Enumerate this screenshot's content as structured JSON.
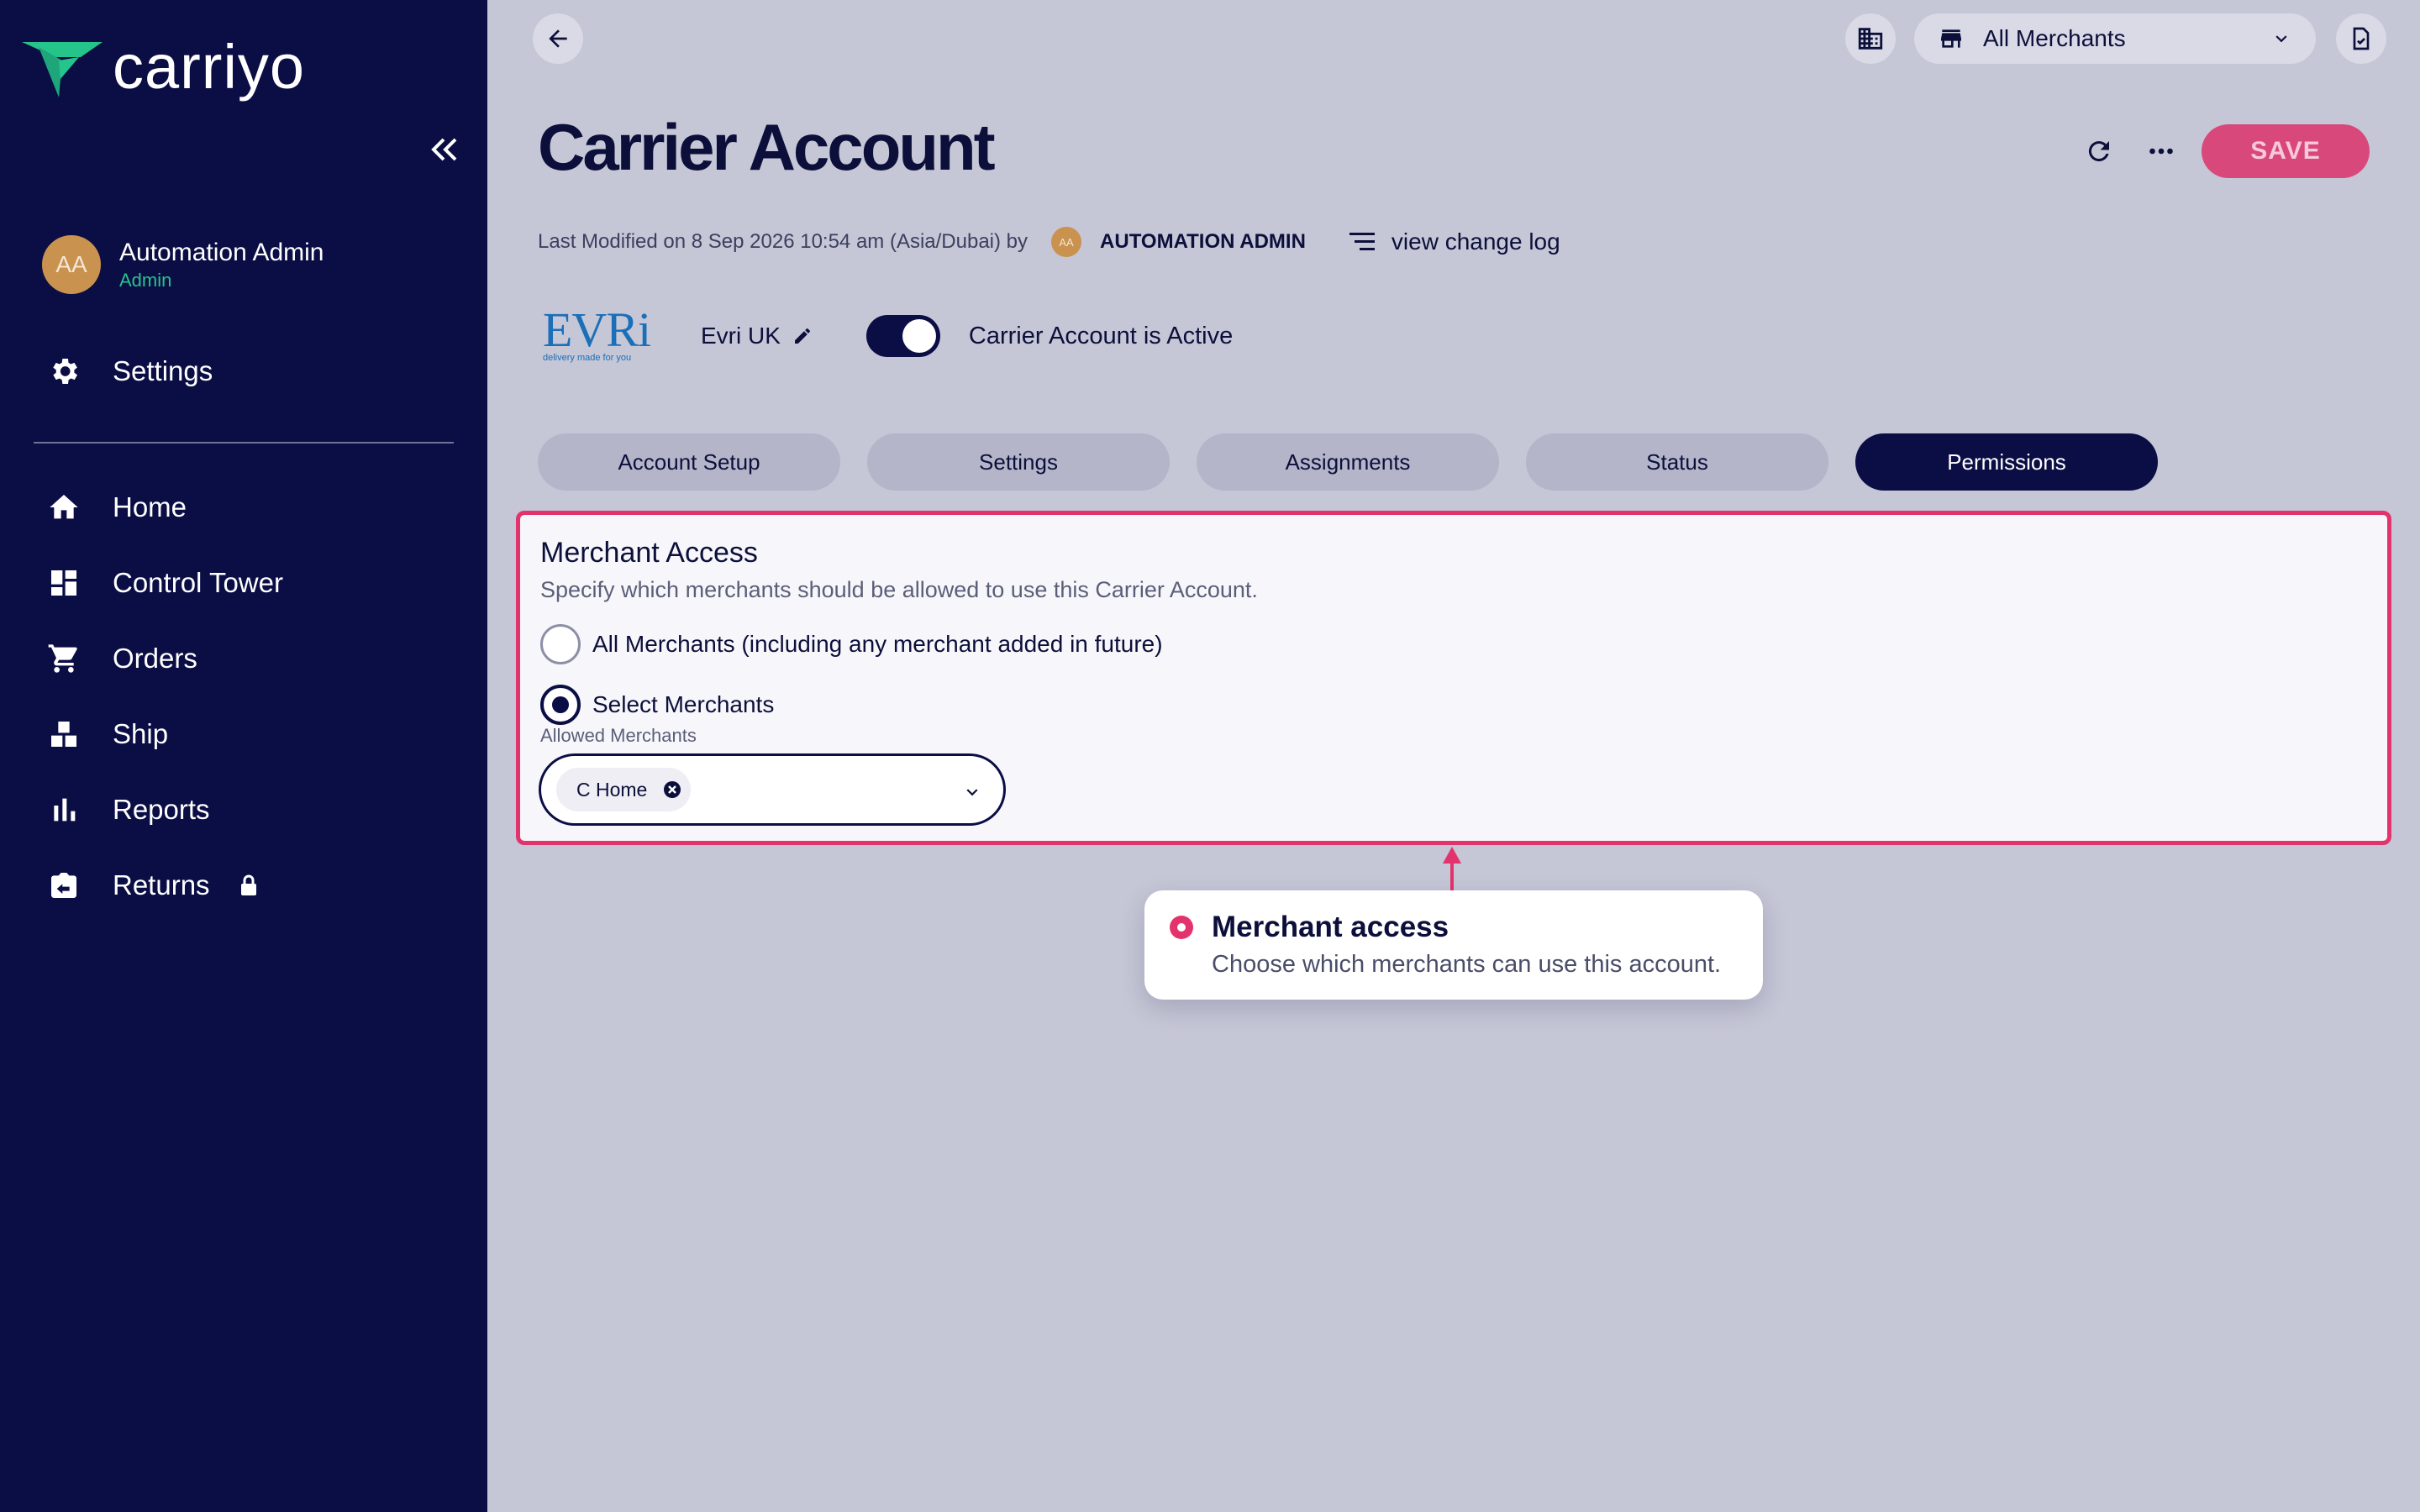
{
  "brand": {
    "name": "carriyo"
  },
  "user": {
    "initials": "AA",
    "name": "Automation Admin",
    "role": "Admin"
  },
  "sidebar": {
    "settings_label": "Settings",
    "items": [
      {
        "label": "Home",
        "icon": "home-icon"
      },
      {
        "label": "Control Tower",
        "icon": "dashboard-icon"
      },
      {
        "label": "Orders",
        "icon": "cart-icon"
      },
      {
        "label": "Ship",
        "icon": "boxes-icon"
      },
      {
        "label": "Reports",
        "icon": "bar-chart-icon"
      },
      {
        "label": "Returns",
        "icon": "return-box-icon",
        "locked": true
      }
    ]
  },
  "topbar": {
    "merchant_select": "All Merchants"
  },
  "header": {
    "title": "Carrier Account",
    "save_label": "SAVE",
    "last_modified": "Last Modified on 8 Sep 2026 10:54 am (Asia/Dubai) by",
    "modifier_initials": "AA",
    "modifier_name": "AUTOMATION ADMIN",
    "changelog_label": "view change log"
  },
  "carrier": {
    "logo_word": "EVRi",
    "logo_tagline": "delivery made for you",
    "name": "Evri UK",
    "active": true,
    "active_label": "Carrier Account is Active"
  },
  "tabs": [
    {
      "label": "Account Setup",
      "active": false
    },
    {
      "label": "Settings",
      "active": false
    },
    {
      "label": "Assignments",
      "active": false
    },
    {
      "label": "Status",
      "active": false
    },
    {
      "label": "Permissions",
      "active": true
    }
  ],
  "merchant_access": {
    "title": "Merchant Access",
    "subtitle": "Specify which merchants should be allowed to use this Carrier Account.",
    "option_all": "All Merchants (including any merchant added in future)",
    "option_select": "Select Merchants",
    "selected_option": "select",
    "field_label": "Allowed Merchants",
    "chips": [
      "C Home"
    ]
  },
  "callout": {
    "title": "Merchant access",
    "text": "Choose which merchants can use this account."
  },
  "colors": {
    "sidebar_bg": "#0b0d45",
    "page_bg": "#c5c6d6",
    "accent": "#e3336c",
    "save_bg": "#d9487a",
    "role_green": "#25c48b"
  }
}
